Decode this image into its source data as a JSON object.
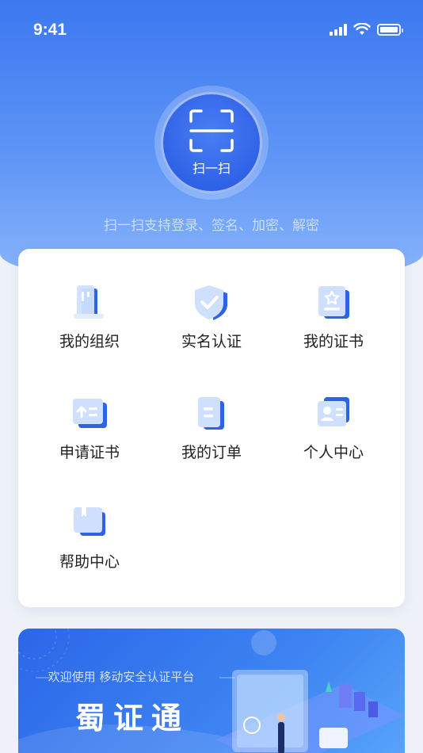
{
  "status_bar": {
    "time": "9:41",
    "icons": [
      "signal-icon",
      "wifi-icon",
      "battery-icon"
    ]
  },
  "scan": {
    "label": "扫一扫",
    "caption": "扫一扫支持登录、签名、加密、解密",
    "icon": "scan-frame-icon"
  },
  "menu": {
    "items": [
      {
        "label": "我的组织",
        "icon": "organization-icon"
      },
      {
        "label": "实名认证",
        "icon": "shield-check-icon"
      },
      {
        "label": "我的证书",
        "icon": "certificate-icon"
      },
      {
        "label": "申请证书",
        "icon": "apply-certificate-icon"
      },
      {
        "label": "我的订单",
        "icon": "order-icon"
      },
      {
        "label": "个人中心",
        "icon": "profile-card-icon"
      },
      {
        "label": "帮助中心",
        "icon": "help-book-icon"
      }
    ]
  },
  "banner": {
    "subtitle": "欢迎使用 移动安全认证平台",
    "title": "蜀证通"
  },
  "colors": {
    "primary": "#3c78f0",
    "accent": "#2f63e6",
    "icon_light": "#cfe0ff"
  }
}
